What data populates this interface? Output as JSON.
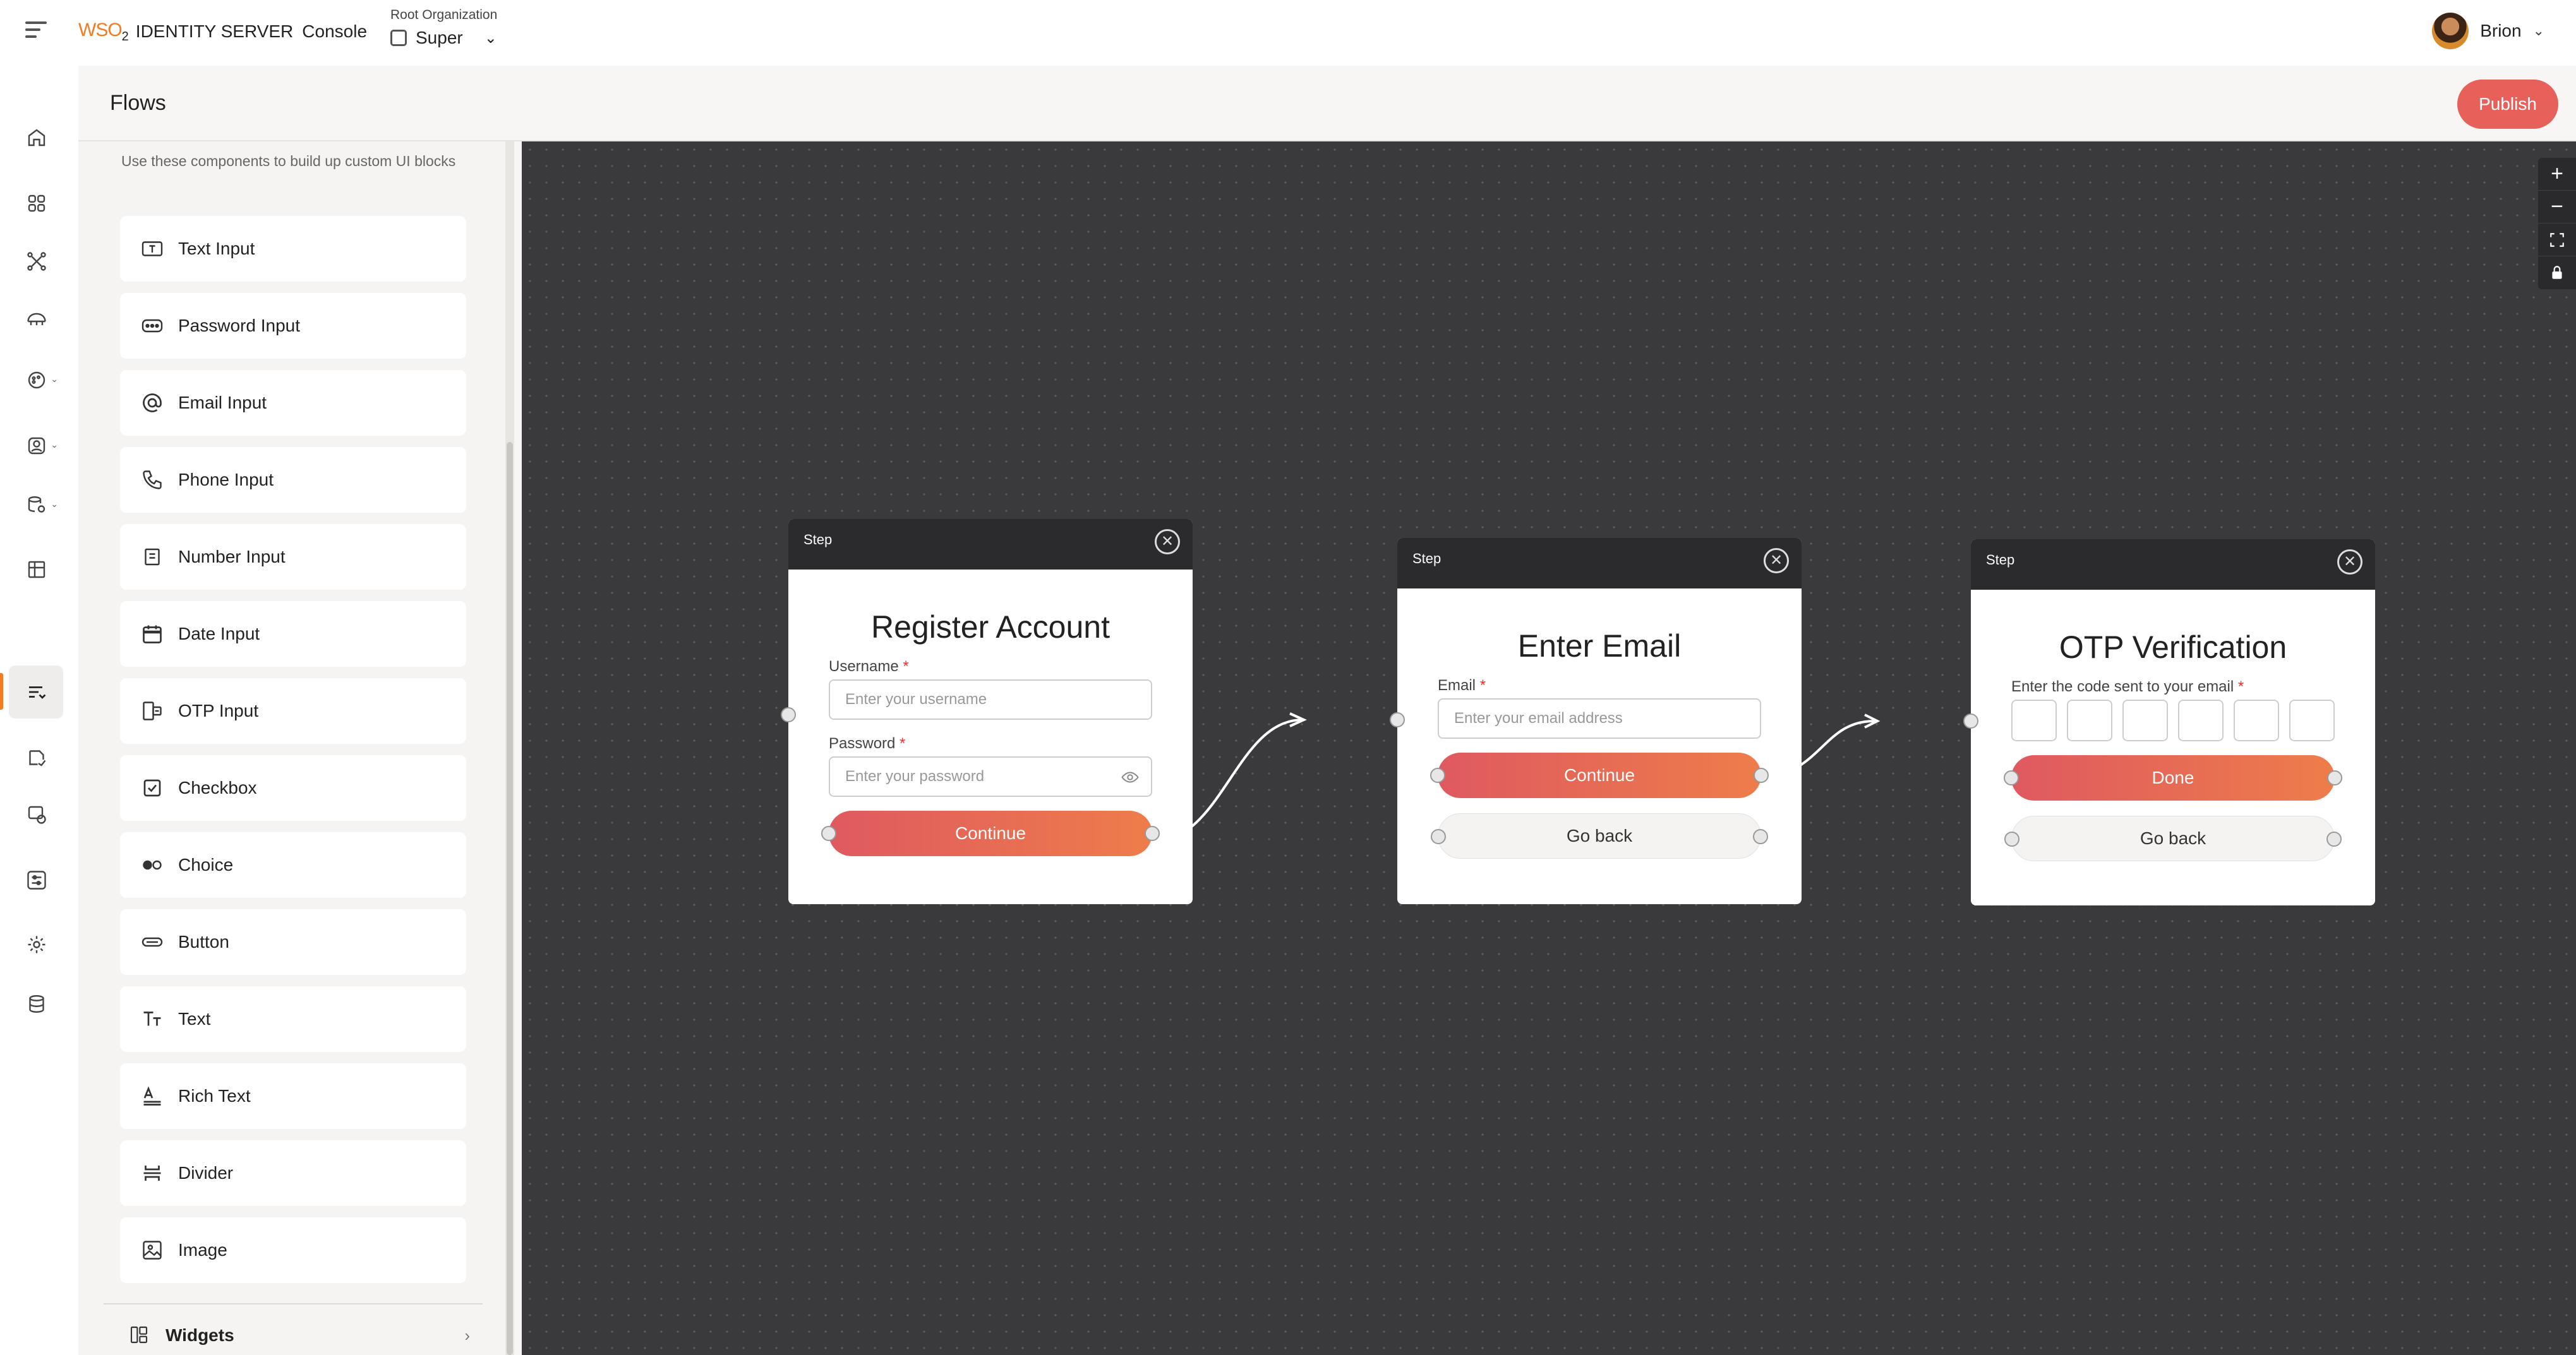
{
  "app": {
    "brand": "WSO",
    "brand_sub": "2",
    "product": "IDENTITY SERVER",
    "console": "Console"
  },
  "org": {
    "label": "Root Organization",
    "selected": "Super"
  },
  "user": {
    "name": "Brion"
  },
  "page": {
    "title": "Flows",
    "publish_label": "Publish"
  },
  "nav": [
    {
      "icon": "home-icon"
    },
    {
      "icon": "applications-icon"
    },
    {
      "icon": "connections-icon"
    },
    {
      "icon": "api-resources-icon"
    },
    {
      "icon": "branding-icon"
    },
    {
      "icon": "user-management-icon"
    },
    {
      "icon": "user-attributes-icon"
    },
    {
      "icon": "organizations-icon"
    },
    {
      "icon": "flows-icon"
    },
    {
      "icon": "login-security-icon"
    },
    {
      "icon": "actions-icon"
    },
    {
      "icon": "workflows-icon"
    },
    {
      "icon": "settings-icon"
    },
    {
      "icon": "database-icon"
    }
  ],
  "panel": {
    "description": "Use these components to build up custom UI blocks",
    "components": [
      {
        "label": "Text Input",
        "icon": "text-input-icon"
      },
      {
        "label": "Password Input",
        "icon": "password-input-icon"
      },
      {
        "label": "Email Input",
        "icon": "email-input-icon"
      },
      {
        "label": "Phone Input",
        "icon": "phone-input-icon"
      },
      {
        "label": "Number Input",
        "icon": "number-input-icon"
      },
      {
        "label": "Date Input",
        "icon": "date-input-icon"
      },
      {
        "label": "OTP Input",
        "icon": "otp-input-icon"
      },
      {
        "label": "Checkbox",
        "icon": "checkbox-icon"
      },
      {
        "label": "Choice",
        "icon": "choice-icon"
      },
      {
        "label": "Button",
        "icon": "button-icon"
      },
      {
        "label": "Text",
        "icon": "text-icon"
      },
      {
        "label": "Rich Text",
        "icon": "rich-text-icon"
      },
      {
        "label": "Divider",
        "icon": "divider-icon"
      },
      {
        "label": "Image",
        "icon": "image-icon"
      }
    ],
    "widgets_label": "Widgets"
  },
  "steps": [
    {
      "header": "Step",
      "title": "Register Account",
      "fields": [
        {
          "label": "Username",
          "placeholder": "Enter your username"
        },
        {
          "label": "Password",
          "placeholder": "Enter your password"
        }
      ],
      "primary": "Continue"
    },
    {
      "header": "Step",
      "title": "Enter Email",
      "fields": [
        {
          "label": "Email",
          "placeholder": "Enter your email address"
        }
      ],
      "primary": "Continue",
      "secondary": "Go back"
    },
    {
      "header": "Step",
      "title": "OTP Verification",
      "otp_label": "Enter the code sent to your email",
      "primary": "Done",
      "secondary": "Go back"
    }
  ],
  "colors": {
    "accent": "#f47b20",
    "publish": "#e8605a",
    "canvas": "#3a393c"
  }
}
